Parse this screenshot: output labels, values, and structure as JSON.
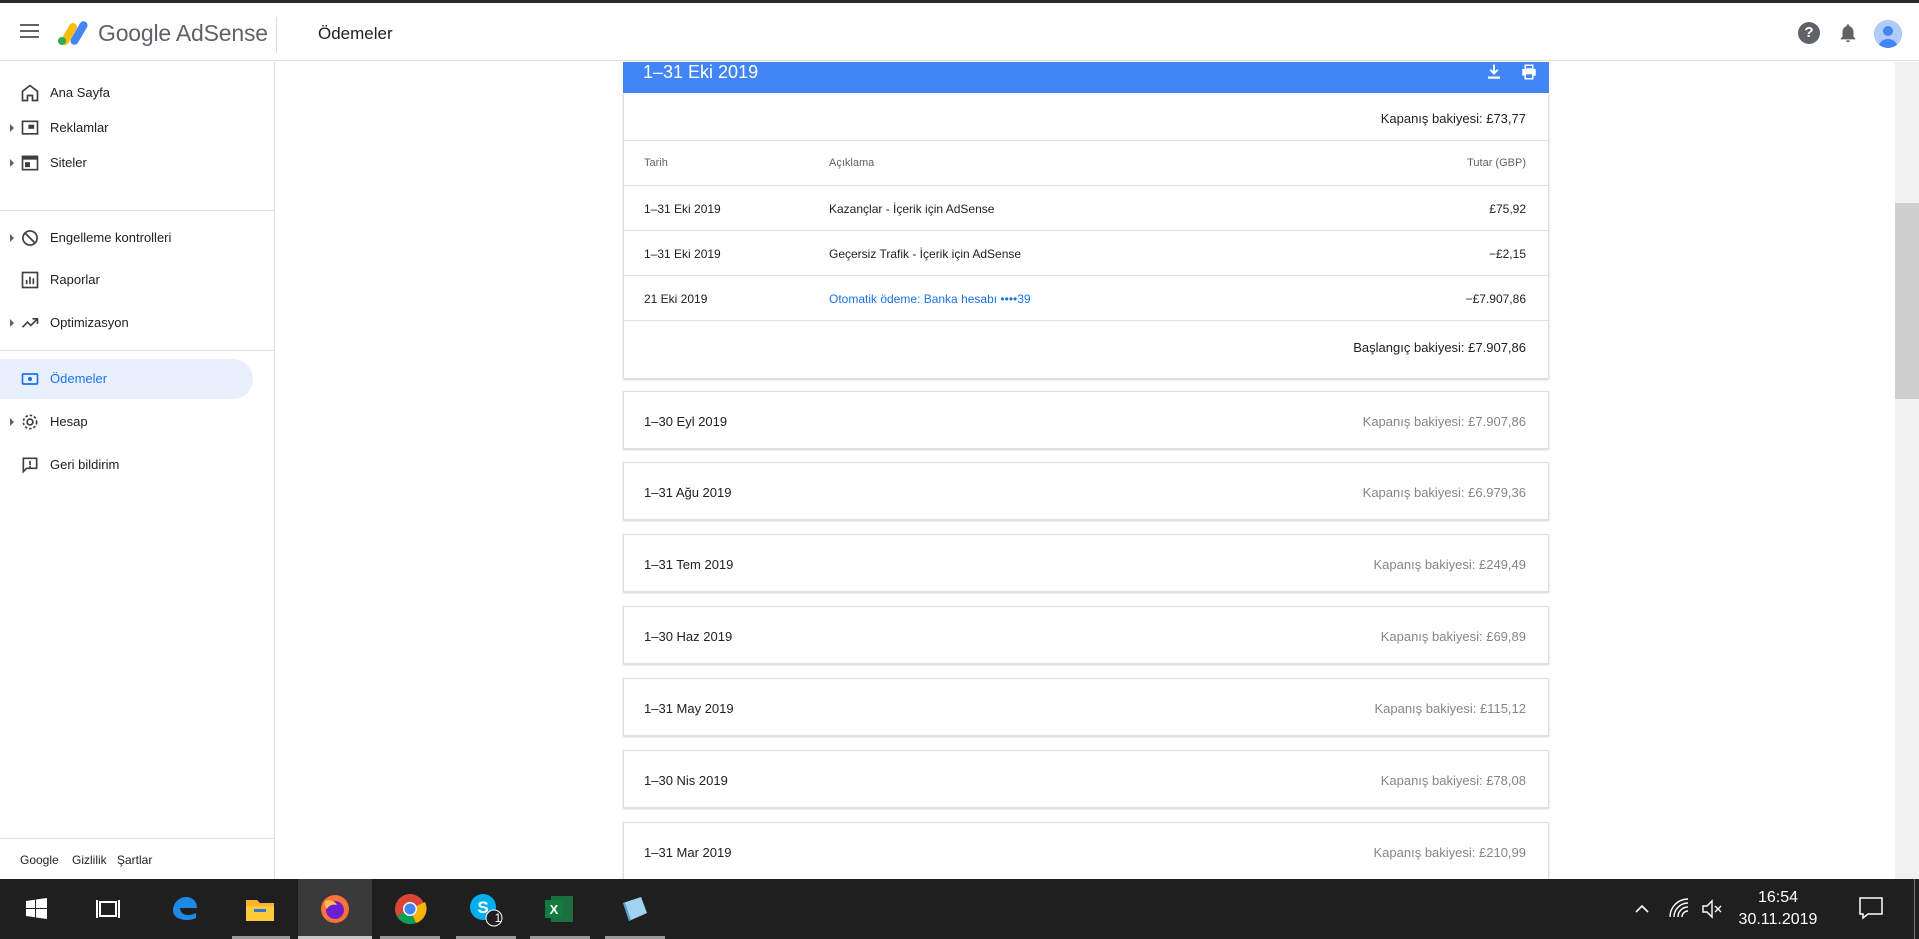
{
  "header": {
    "brand": "Google AdSense",
    "page_title": "Ödemeler"
  },
  "sidebar": {
    "items": [
      {
        "label": "Ana Sayfa",
        "icon": "home-icon"
      },
      {
        "label": "Reklamlar",
        "icon": "ads-icon"
      },
      {
        "label": "Siteler",
        "icon": "sites-icon"
      },
      {
        "label": "Engelleme kontrolleri",
        "icon": "block-icon"
      },
      {
        "label": "Raporlar",
        "icon": "reports-icon"
      },
      {
        "label": "Optimizasyon",
        "icon": "trending-icon"
      },
      {
        "label": "Ödemeler",
        "icon": "payments-icon",
        "active": true
      },
      {
        "label": "Hesap",
        "icon": "gear-icon"
      },
      {
        "label": "Geri bildirim",
        "icon": "feedback-icon"
      }
    ],
    "footer": {
      "google": "Google",
      "privacy": "Gizlilik",
      "terms": "Şartlar"
    }
  },
  "statement": {
    "period": "1–31 Eki 2019",
    "closing_balance": "Kapanış bakiyesi: £73,77",
    "columns": {
      "date": "Tarih",
      "description": "Açıklama",
      "amount": "Tutar (GBP)"
    },
    "rows": [
      {
        "date": "1–31 Eki 2019",
        "description": "Kazançlar - İçerik için AdSense",
        "amount": "£75,92"
      },
      {
        "date": "1–31 Eki 2019",
        "description": "Geçersiz Trafik - İçerik için AdSense",
        "amount": "−£2,15"
      },
      {
        "date": "21 Eki 2019",
        "description": "Otomatik ödeme: Banka hesabı  ••••39",
        "amount": "−£7.907,86"
      }
    ],
    "opening_balance": "Başlangıç bakiyesi: £7.907,86"
  },
  "months": [
    {
      "period": "1–30 Eyl 2019",
      "balance": "Kapanış bakiyesi: £7.907,86"
    },
    {
      "period": "1–31 Ağu 2019",
      "balance": "Kapanış bakiyesi: £6.979,36"
    },
    {
      "period": "1–31 Tem 2019",
      "balance": "Kapanış bakiyesi: £249,49"
    },
    {
      "period": "1–30 Haz 2019",
      "balance": "Kapanış bakiyesi: £69,89"
    },
    {
      "period": "1–31 May 2019",
      "balance": "Kapanış bakiyesi: £115,12"
    },
    {
      "period": "1–30 Nis 2019",
      "balance": "Kapanış bakiyesi: £78,08"
    },
    {
      "period": "1–31 Mar 2019",
      "balance": "Kapanış bakiyesi: £210,99"
    }
  ],
  "taskbar": {
    "time": "16:54",
    "date": "30.11.2019",
    "skype_badge": "1",
    "apps": [
      "windows-start-icon",
      "task-view-icon",
      "edge-icon",
      "file-explorer-icon",
      "firefox-icon",
      "chrome-icon",
      "skype-icon",
      "excel-icon",
      "notepad-icon"
    ]
  },
  "colors": {
    "accent": "#4285f4",
    "link": "#1a73e8",
    "active_bg": "#e8f0fe"
  }
}
